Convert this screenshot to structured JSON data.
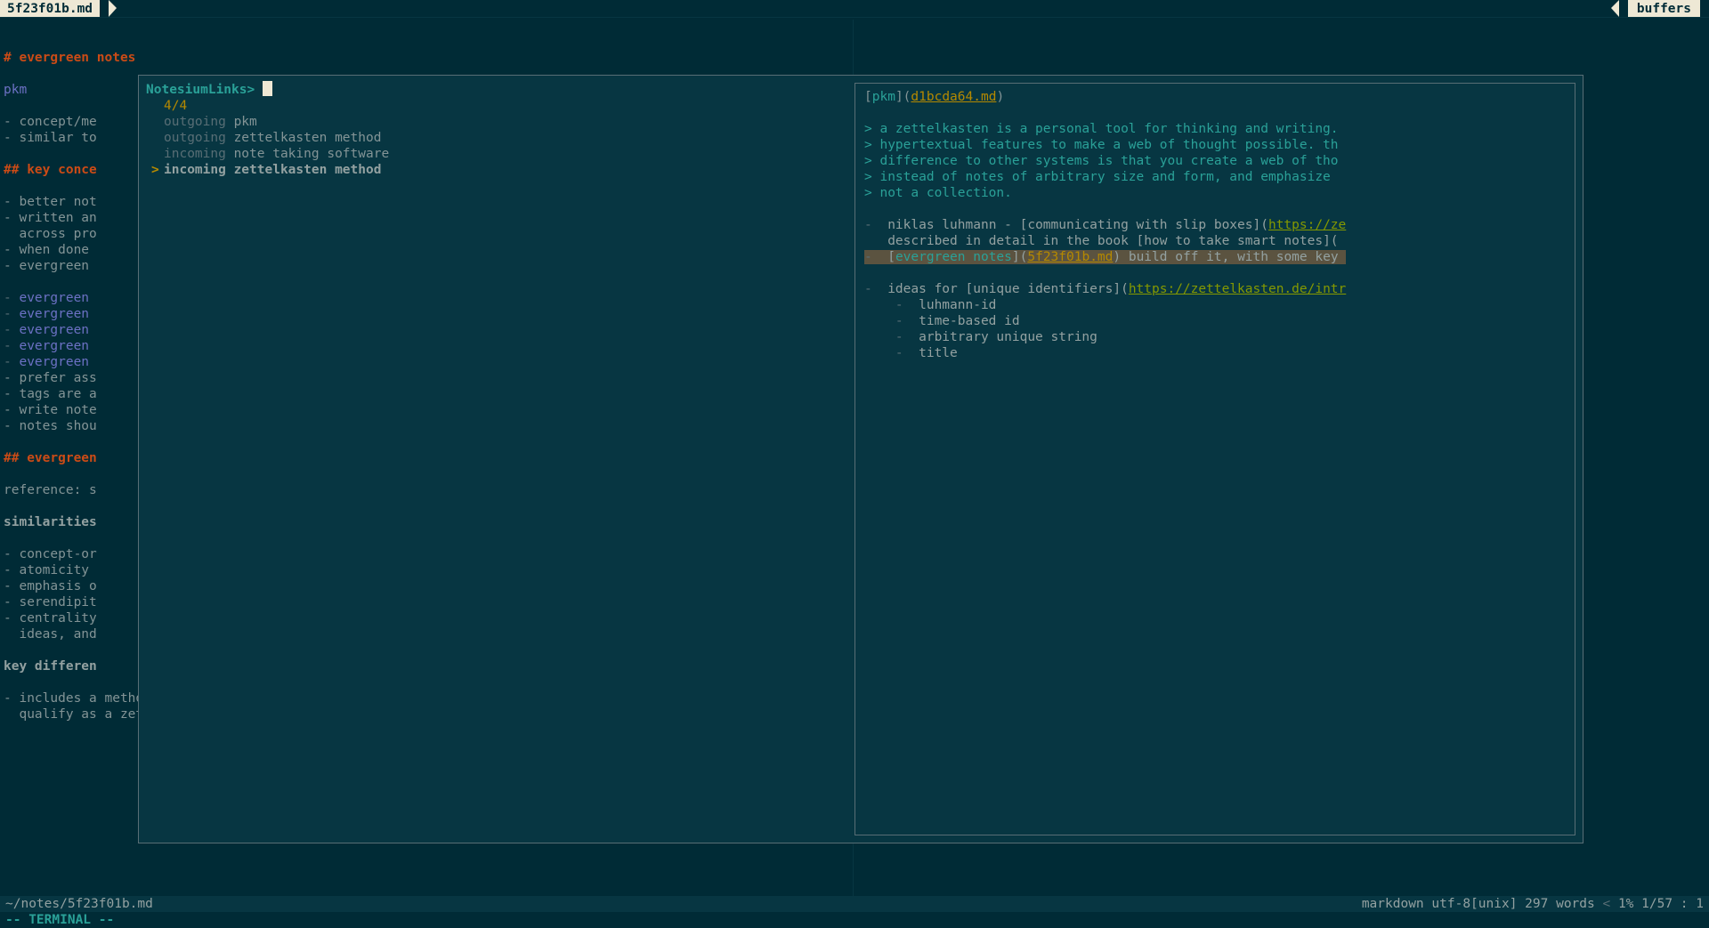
{
  "tab_label": "5f23f01b.md",
  "buffers_label": "buffers",
  "editor": {
    "h1": "# evergreen notes",
    "pkm_link": "pkm",
    "lines1": [
      "- concept/me",
      "- similar to"
    ],
    "h2a": "## key conce",
    "lines2": [
      "- better not",
      "- written an",
      "  across pro",
      "- when done",
      "- evergreen"
    ],
    "links_block": [
      "- evergreen",
      "- evergreen",
      "- evergreen",
      "- evergreen",
      "- evergreen"
    ],
    "lines3": [
      "- prefer ass",
      "- tags are a",
      "- write note",
      "- notes shou"
    ],
    "h2b": "## evergreen",
    "ref": "reference: s",
    "sim_head": "similarities",
    "lines4": [
      "- concept-or",
      "- atomicity",
      "- emphasis o",
      "- serendipit",
      "- centrality",
      "  ideas, and"
    ],
    "diff_head": "key differen",
    "lines5": [
      "- includes a method for capturing scraps (inbox) which would not yet",
      "  qualify as a zettel, then revising them overtime."
    ]
  },
  "status": {
    "filepath": "~/notes/5f23f01b.md",
    "filetype": "markdown",
    "encoding": "utf-8[unix]",
    "words": "297 words",
    "percent": "1%",
    "position": "1/57 :  1"
  },
  "cmdline": "-- TERMINAL --",
  "popup": {
    "prompt": "NotesiumLinks> ",
    "count": "4/4",
    "results": [
      {
        "dir": "outgoing",
        "text": "pkm"
      },
      {
        "dir": "outgoing",
        "text": "zettelkasten method"
      },
      {
        "dir": "incoming",
        "text": "note taking software"
      },
      {
        "dir": "incoming",
        "text": "zettelkasten method",
        "selected": true
      }
    ],
    "preview": {
      "pkm_label": "pkm",
      "pkm_file": "d1bcda64.md",
      "quotes": [
        "> a zettelkasten is a personal tool for thinking and writing.",
        "> hypertextual features to make a web of thought possible. th",
        "> difference to other systems is that you create a web of tho",
        "> instead of notes of arbitrary size and form, and emphasize",
        "> not a collection."
      ],
      "item1_pre": "niklas luhmann - [communicating with slip boxes](",
      "item1_url": "https://ze",
      "item2": "described in detail in the book [how to take smart notes](",
      "item3_label": "evergreen notes",
      "item3_file": "5f23f01b.md",
      "item3_rest": ") build off it, with some key ",
      "item4_pre": "ideas for [unique identifiers](",
      "item4_url": "https://zettelkasten.de/intr",
      "sub": [
        "luhmann-id",
        "time-based id",
        "arbitrary unique string",
        "title"
      ]
    }
  }
}
